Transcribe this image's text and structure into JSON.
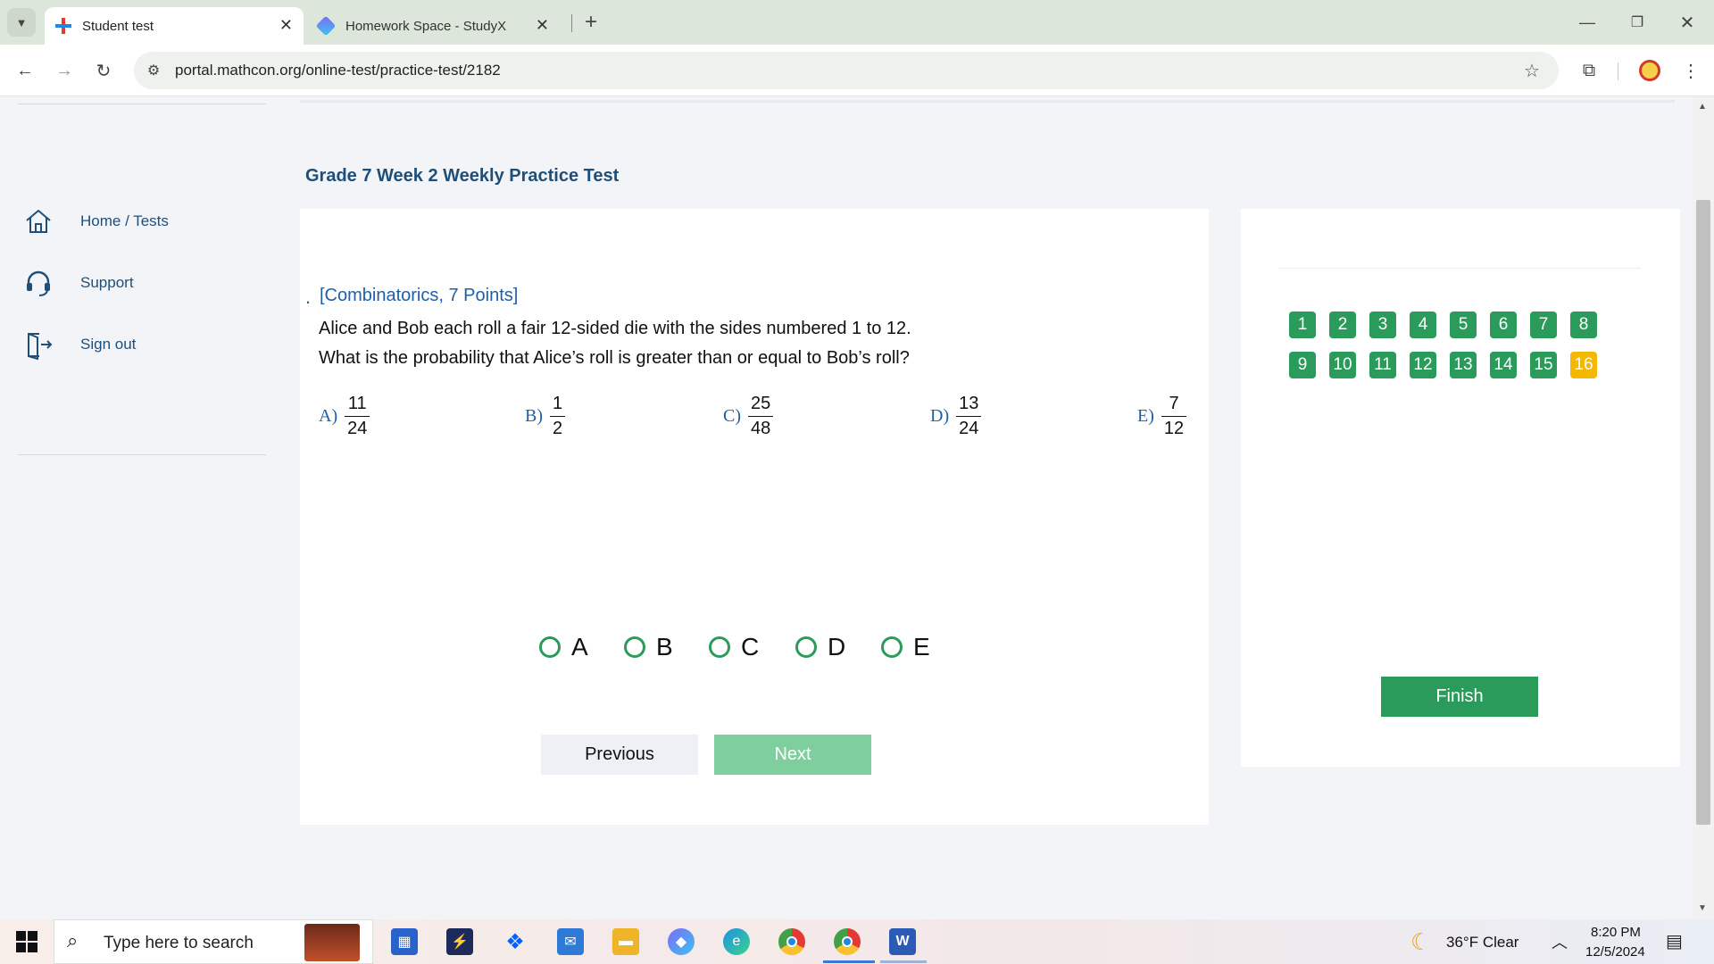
{
  "browser": {
    "tabs": [
      {
        "title": "Student test",
        "active": true
      },
      {
        "title": "Homework Space - StudyX",
        "active": false
      }
    ],
    "url": "portal.mathcon.org/online-test/practice-test/2182"
  },
  "sidebar": {
    "items": [
      {
        "label": "Home / Tests",
        "icon": "home-icon"
      },
      {
        "label": "Support",
        "icon": "headset-icon"
      },
      {
        "label": "Sign out",
        "icon": "sign-out-icon"
      }
    ]
  },
  "test": {
    "title": "Grade 7 Week 2 Weekly Practice Test",
    "question": {
      "bullet": ".",
      "category": "[Combinatorics, 7 Points]",
      "line1": "Alice and Bob each roll a fair 12-sided die with the sides numbered 1 to 12.",
      "line2": "What is the probability that Alice’s roll is greater than or equal to Bob’s roll?"
    },
    "choices": [
      {
        "label": "A)",
        "num": "11",
        "den": "24"
      },
      {
        "label": "B)",
        "num": "1",
        "den": "2"
      },
      {
        "label": "C)",
        "num": "25",
        "den": "48"
      },
      {
        "label": "D)",
        "num": "13",
        "den": "24"
      },
      {
        "label": "E)",
        "num": "7",
        "den": "12"
      }
    ],
    "options": [
      "A",
      "B",
      "C",
      "D",
      "E"
    ],
    "previous_label": "Previous",
    "next_label": "Next"
  },
  "navigator": {
    "question_numbers": [
      "1",
      "2",
      "3",
      "4",
      "5",
      "6",
      "7",
      "8",
      "9",
      "10",
      "11",
      "12",
      "13",
      "14",
      "15",
      "16"
    ],
    "current": "16",
    "finish_label": "Finish"
  },
  "taskbar": {
    "search_placeholder": "Type here to search",
    "weather": "36°F  Clear",
    "time": "8:20 PM",
    "date": "12/5/2024"
  },
  "colors": {
    "accent_green": "#2a9b5a",
    "current_question": "#f5b800",
    "next_disabled": "#7fcf9e",
    "heading_blue": "#1f4e79",
    "category_blue": "#1d5fa8"
  }
}
